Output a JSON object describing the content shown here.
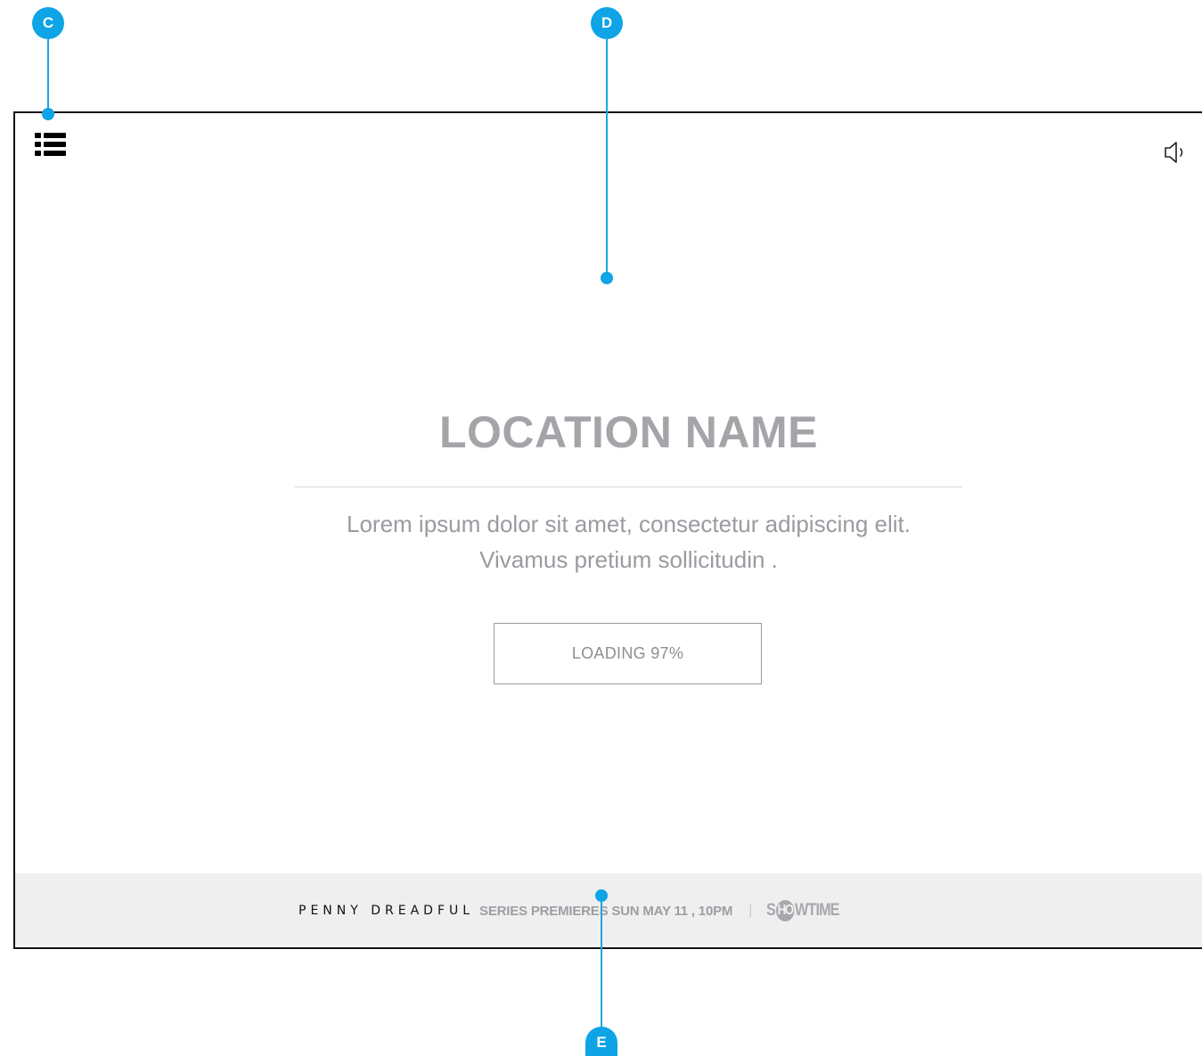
{
  "main": {
    "location_title": "LOCATION NAME",
    "description_line1": "Lorem ipsum dolor sit amet, consectetur adipiscing elit.",
    "description_line2": "Vivamus pretium sollicitudin .",
    "loading_label": "LOADING 97%",
    "loading_progress_percent": 97
  },
  "footer": {
    "show_title": "PENNY DREADFUL",
    "premiere_text": "SERIES PREMIERES SUN MAY 11 , 10PM",
    "separator": "|",
    "network_pre": "S",
    "network_circle": "HO",
    "network_post": "WTIME"
  },
  "annotations": {
    "c": "C",
    "d": "D",
    "e": "E"
  },
  "icons": {
    "menu": "list-menu-icon",
    "speaker": "speaker-icon"
  },
  "colors": {
    "accent": "#0ea4e6",
    "title_gray": "#a3a5a9",
    "footer_bg": "#efefef"
  }
}
